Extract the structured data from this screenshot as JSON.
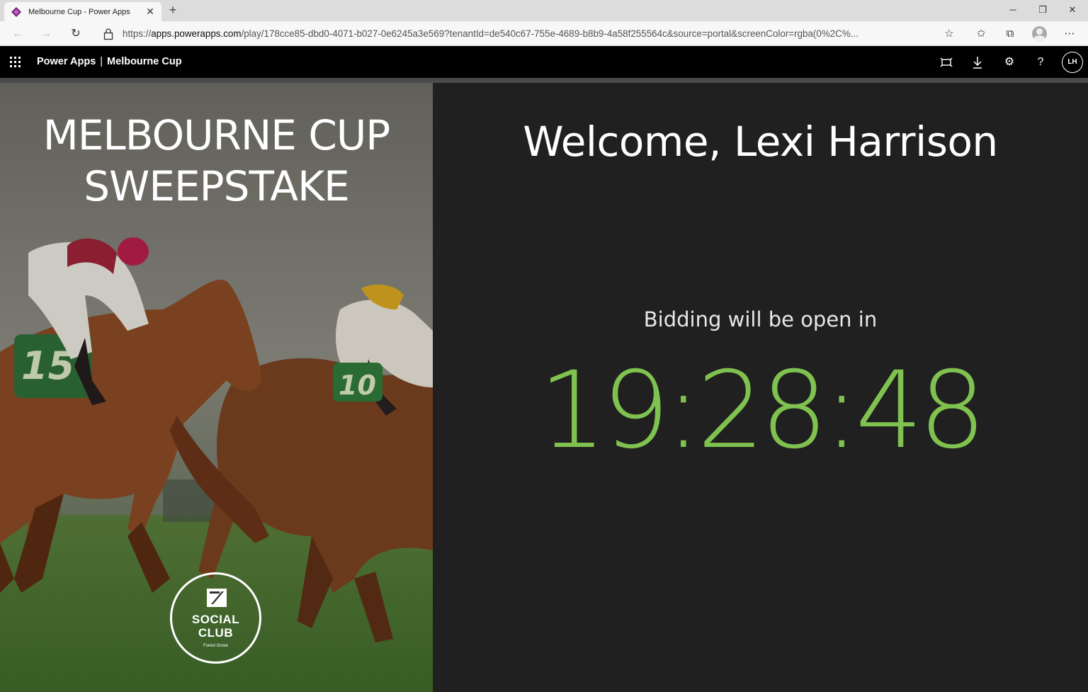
{
  "browser": {
    "tab_title": "Melbourne Cup - Power Apps",
    "url_scheme": "https://",
    "url_host": "apps.powerapps.com",
    "url_rest": "/play/178cce85-dbd0-4071-b027-0e6245a3e569?tenantId=de540c67-755e-4689-b8b9-4a58f255564c&source=portal&screenColor=rgba(0%2C%...",
    "icons": {
      "back": "back-arrow-icon",
      "forward": "forward-arrow-icon",
      "refresh": "refresh-icon",
      "lock": "lock-icon",
      "favorite": "star-icon",
      "favorites": "favorites-icon",
      "collections": "collections-icon",
      "profile": "profile-icon",
      "more": "more-icon"
    }
  },
  "header": {
    "app_name": "Power Apps",
    "separator": "|",
    "title": "Melbourne Cup",
    "avatar_initials": "LH",
    "icons": {
      "fit": "fit-to-screen-icon",
      "download": "download-icon",
      "settings": "gear-icon",
      "help": "help-icon",
      "waffle": "app-launcher-icon"
    }
  },
  "hero": {
    "title_line1": "MELBOURNE CUP",
    "title_line2": "SWEEPSTAKE",
    "logo_line1": "SOCIAL",
    "logo_line2": "CLUB",
    "logo_sub": "Forest Grove"
  },
  "main": {
    "welcome": "Welcome, Lexi Harrison",
    "bidding_label": "Bidding will be open in",
    "countdown": "19:28:48"
  },
  "colors": {
    "accent": "#7fc24f",
    "header_bg": "#000000",
    "panel_bg": "#202020"
  }
}
